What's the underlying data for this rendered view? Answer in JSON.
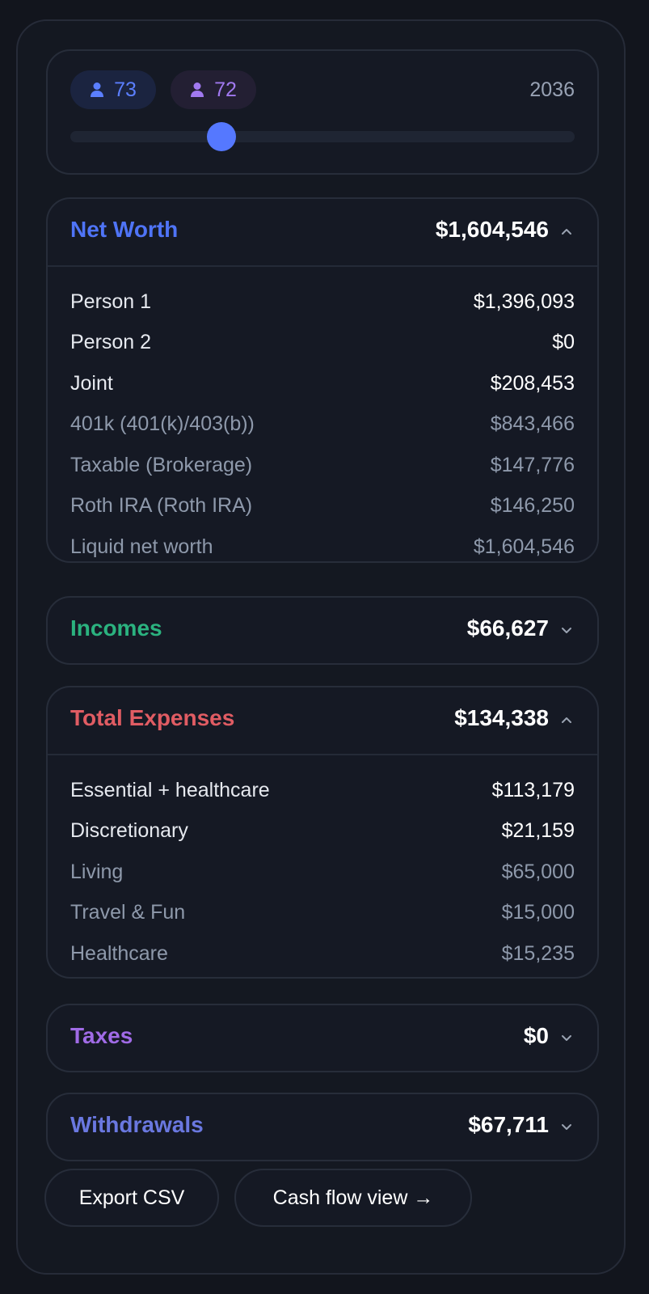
{
  "timeline": {
    "person1_age": "73",
    "person2_age": "72",
    "year": "2036",
    "slider_position": 0.3
  },
  "net_worth": {
    "title": "Net Worth",
    "total": "$1,604,546",
    "expanded": true,
    "rows": [
      {
        "label": "Person 1",
        "value": "$1,396,093"
      },
      {
        "label": "Person 2",
        "value": "$0"
      },
      {
        "label": "Joint",
        "value": "$208,453"
      },
      {
        "label": "401k (401(k)/403(b))",
        "value": "$843,466"
      },
      {
        "label": "Taxable (Brokerage)",
        "value": "$147,776"
      },
      {
        "label": "Roth IRA (Roth IRA)",
        "value": "$146,250"
      },
      {
        "label": "Liquid net worth",
        "value": "$1,604,546"
      }
    ]
  },
  "incomes": {
    "title": "Incomes",
    "total": "$66,627",
    "expanded": false
  },
  "expenses": {
    "title": "Total Expenses",
    "total": "$134,338",
    "expanded": true,
    "rows": [
      {
        "label": "Essential + healthcare",
        "value": "$113,179"
      },
      {
        "label": "Discretionary",
        "value": "$21,159"
      },
      {
        "label": "Living",
        "value": "$65,000"
      },
      {
        "label": "Travel & Fun",
        "value": "$15,000"
      },
      {
        "label": "Healthcare",
        "value": "$15,235"
      }
    ]
  },
  "taxes": {
    "title": "Taxes",
    "total": "$0",
    "expanded": false
  },
  "withdrawals": {
    "title": "Withdrawals",
    "total": "$67,711",
    "expanded": false
  },
  "actions": {
    "export_label": "Export CSV",
    "cashflow_label": "Cash flow view →"
  },
  "colors": {
    "accent_blue": "#4f74f7",
    "income_green": "#2bb27f",
    "expense_red": "#e05c63",
    "tax_purple": "#a06be6",
    "withdrawal_indigo": "#6a78e0"
  },
  "icons": {
    "person": "person-icon",
    "expanded": "chevron-up-icon",
    "collapsed": "chevron-down-icon"
  }
}
